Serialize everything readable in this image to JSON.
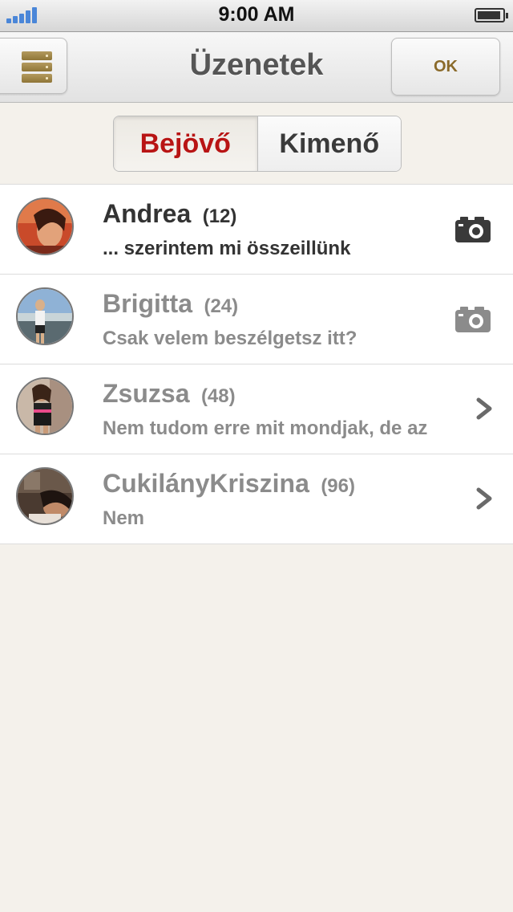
{
  "status_bar": {
    "time": "9:00 AM"
  },
  "nav": {
    "title": "Üzenetek",
    "ok_label": "OK"
  },
  "segments": {
    "inbox": "Bejövő",
    "outbox": "Kimenő",
    "selected": "Bejövő"
  },
  "messages": [
    {
      "name": "Andrea",
      "count": "(12)",
      "preview": "... szerintem mi összeillünk",
      "status": "unread",
      "trail_icon": "camera-icon"
    },
    {
      "name": "Brigitta",
      "count": "(24)",
      "preview": "Csak velem beszélgetsz itt?",
      "status": "read",
      "trail_icon": "camera-icon"
    },
    {
      "name": "Zsuzsa",
      "count": "(48)",
      "preview": "Nem tudom erre mit mondjak, de az",
      "status": "read",
      "trail_icon": "chevron-right-icon"
    },
    {
      "name": "CukilányKriszina",
      "count": "(96)",
      "preview": "Nem",
      "status": "read",
      "trail_icon": "chevron-right-icon"
    }
  ],
  "colors": {
    "accent_red": "#b81414",
    "background": "#f4f1eb",
    "menu_gold": "#a08444"
  }
}
